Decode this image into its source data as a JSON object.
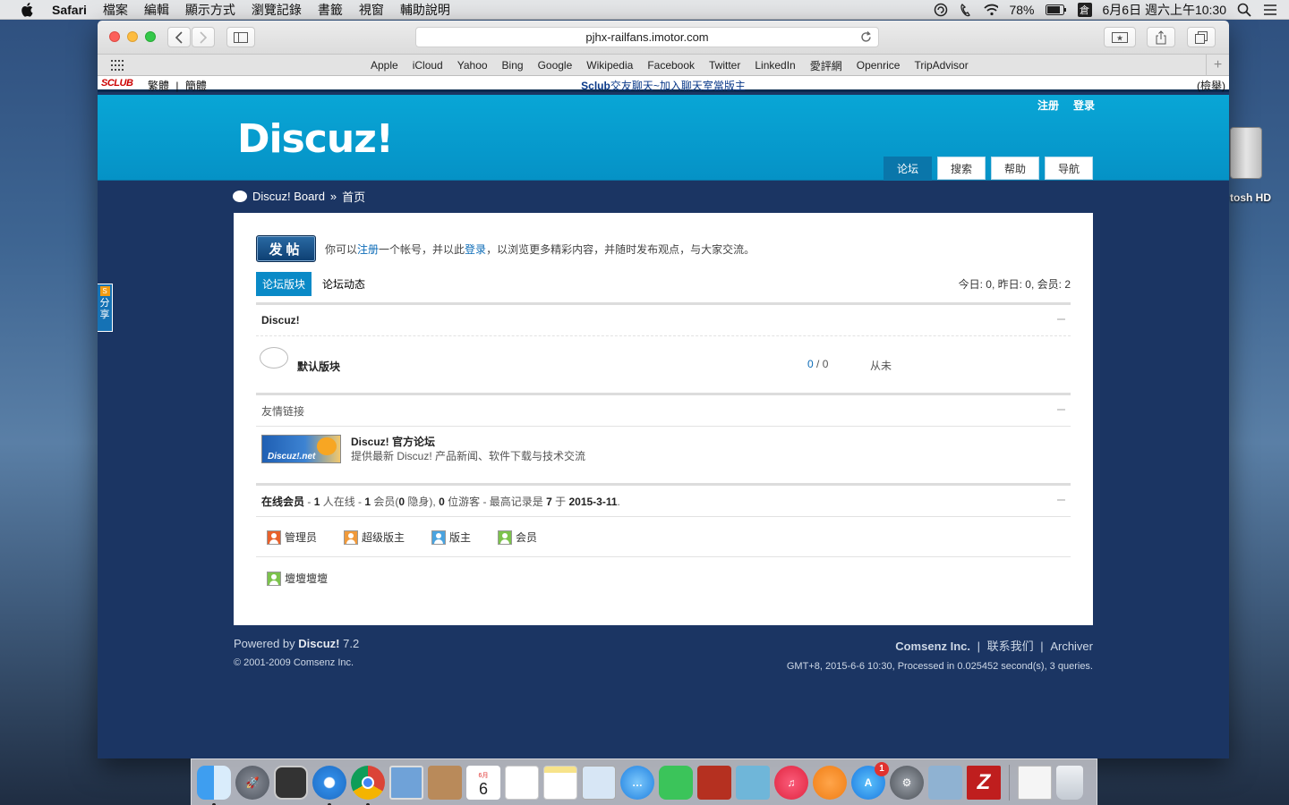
{
  "menubar": {
    "app_name": "Safari",
    "items": [
      "檔案",
      "編輯",
      "顯示方式",
      "瀏覽記錄",
      "書籤",
      "視窗",
      "輔助說明"
    ],
    "battery": "78%",
    "input_method": "倉",
    "datetime": "6月6日 週六上午10:30"
  },
  "desktop": {
    "disk_label": "tosh HD"
  },
  "browser": {
    "url": "pjhx-railfans.imotor.com",
    "favorites": [
      "Apple",
      "iCloud",
      "Yahoo",
      "Bing",
      "Google",
      "Wikipedia",
      "Facebook",
      "Twitter",
      "LinkedIn",
      "愛評網",
      "Openrice",
      "TripAdvisor"
    ]
  },
  "sclub_bar": {
    "logo": "SCLUB",
    "lang_trad": "繁體",
    "lang_sep": "|",
    "lang_simp": "簡體",
    "brand": "Sclub",
    "promo": "交友聊天~加入聊天室當版主",
    "report": "(檢舉)"
  },
  "header": {
    "logo": "Discuz!",
    "register": "注册",
    "login": "登录",
    "nav": [
      {
        "label": "论坛",
        "active": true
      },
      {
        "label": "搜索",
        "active": false
      },
      {
        "label": "帮助",
        "active": false
      },
      {
        "label": "导航",
        "active": false
      }
    ]
  },
  "share": {
    "label_1": "分",
    "label_2": "享",
    "s": "S"
  },
  "breadcrumb": {
    "board": "Discuz! Board",
    "sep": "»",
    "current": "首页"
  },
  "main": {
    "post_button": "发帖",
    "notice_1": "你可以",
    "notice_register": "注册",
    "notice_2": "一个帐号，并以此",
    "notice_login": "登录",
    "notice_3": "，以浏览更多精彩内容，并随时发布观点，与大家交流。",
    "tab_forums": "论坛版块",
    "tab_activity": "论坛动态",
    "stats": "今日: 0, 昨日: 0, 会员: 2",
    "category": "Discuz!",
    "forum": {
      "name": "默认版块",
      "threads": "0",
      "sep": " / ",
      "posts": "0",
      "last_post": "从未"
    },
    "links_title": "友情链接",
    "link": {
      "banner_text": "Discuz!.net",
      "title": "Discuz! 官方论坛",
      "desc": "提供最新 Discuz! 产品新闻、软件下载与技术交流"
    },
    "online": {
      "label": "在线会员",
      "dash1": " - ",
      "total": "1",
      "t1": " 人在线 - ",
      "members": "1",
      "t2": " 会员(",
      "hidden": "0",
      "t3": " 隐身), ",
      "guests": "0",
      "t4": " 位游客 - 最高记录是 ",
      "record": "7",
      "t5": " 于 ",
      "record_date": "2015-3-11",
      "t6": "."
    },
    "roles": [
      {
        "label": "管理员",
        "color": "#e8612c"
      },
      {
        "label": "超级版主",
        "color": "#f09a3b"
      },
      {
        "label": "版主",
        "color": "#4aa3df"
      },
      {
        "label": "会员",
        "color": "#7cc24c"
      }
    ],
    "online_user": "壇壇壇壇"
  },
  "footer": {
    "powered": "Powered by ",
    "product": "Discuz!",
    "version": " 7.2",
    "copyright": "© 2001-2009 Comsenz Inc.",
    "company": "Comsenz Inc.",
    "contact": "联系我们",
    "archiver": "Archiver",
    "sep": "|",
    "info": "GMT+8, 2015-6-6 10:30, Processed in 0.025452 second(s), 3 queries."
  },
  "dock": {
    "calendar_month": "6月",
    "calendar_day": "6",
    "appstore_badge": "1",
    "apps": [
      "finder",
      "launchpad",
      "mission-control",
      "safari",
      "chrome",
      "preview",
      "contacts",
      "calendar",
      "reminders",
      "notes",
      "photo-booth",
      "messages",
      "facetime",
      "photos",
      "iphoto",
      "itunes",
      "ibooks",
      "app-store",
      "system-preferences",
      "migration-assistant",
      "filezilla",
      "textedit",
      "trash"
    ]
  }
}
